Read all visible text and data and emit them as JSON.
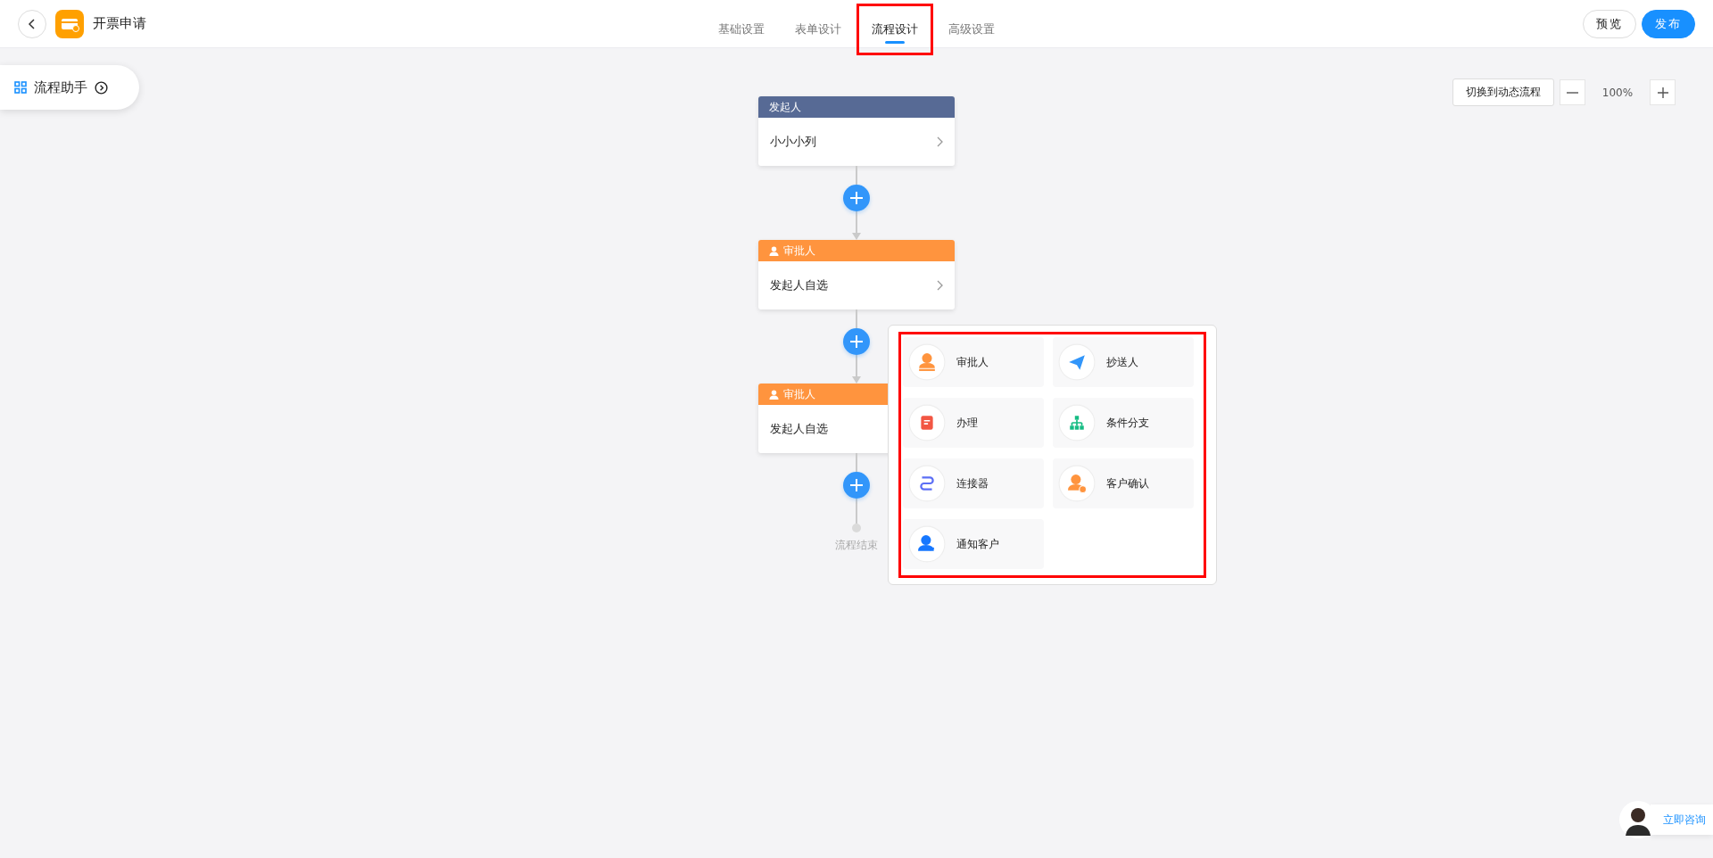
{
  "header": {
    "title": "开票申请",
    "tabs": [
      {
        "label": "基础设置",
        "selected": false,
        "highlighted": false
      },
      {
        "label": "表单设计",
        "selected": false,
        "highlighted": false
      },
      {
        "label": "流程设计",
        "selected": true,
        "highlighted": true
      },
      {
        "label": "高级设置",
        "selected": false,
        "highlighted": false
      }
    ],
    "buttons": [
      {
        "label": "预览",
        "kind": "secondary"
      },
      {
        "label": "发布",
        "kind": "primary"
      }
    ]
  },
  "assistant": {
    "label": "流程助手"
  },
  "zoom_controls": {
    "switch_label": "切换到动态流程",
    "zoom": "100%"
  },
  "flow": {
    "nodes": [
      {
        "kind": "initiator",
        "title": "发起人",
        "content": "小小小列"
      },
      {
        "kind": "approver",
        "title": "审批人",
        "content": "发起人自选",
        "add_menu": {
          "highlighted": true,
          "items": [
            {
              "kind": "approver",
              "label": "审批人"
            },
            {
              "kind": "cc",
              "label": "抄送人"
            },
            {
              "kind": "handle",
              "label": "办理"
            },
            {
              "kind": "branch",
              "label": "条件分支"
            },
            {
              "kind": "connector",
              "label": "连接器"
            },
            {
              "kind": "customer_confirm",
              "label": "客户确认"
            },
            {
              "kind": "notify",
              "label": "通知客户"
            }
          ]
        }
      },
      {
        "kind": "approver",
        "title": "审批人",
        "content": "发起人自选"
      }
    ],
    "end_label": "流程结束"
  },
  "consult": {
    "label": "立即咨询"
  }
}
